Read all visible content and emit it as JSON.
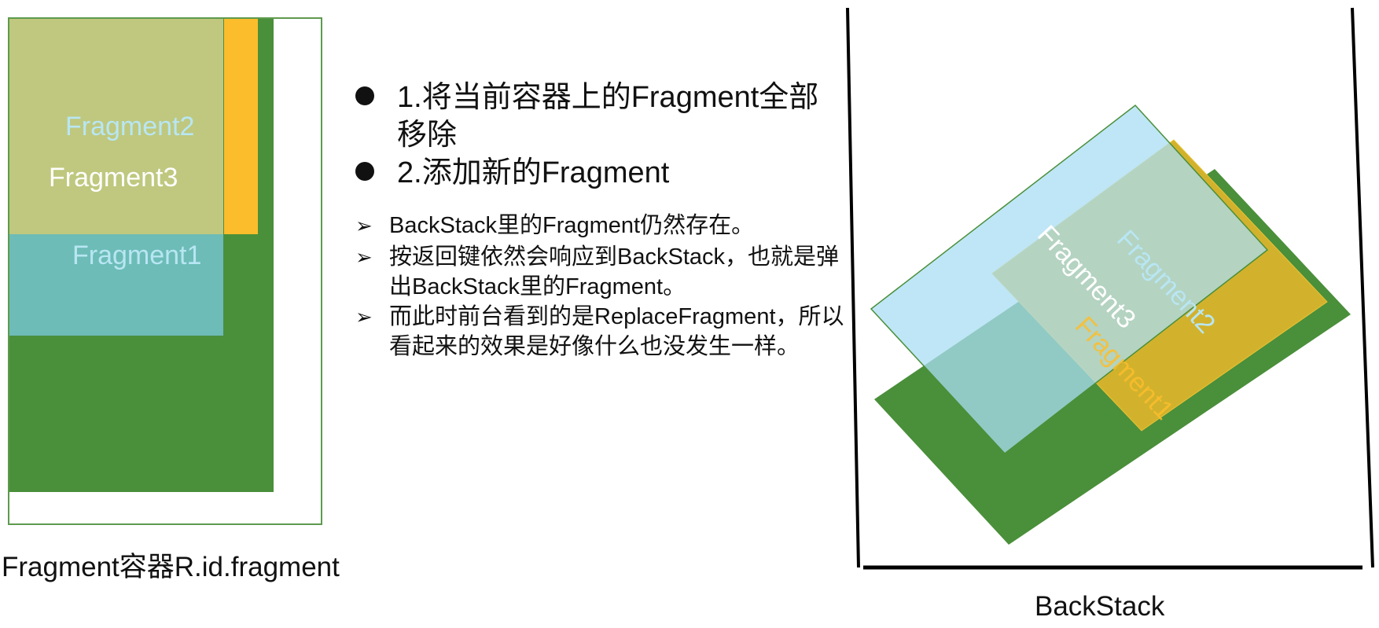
{
  "container": {
    "labels": {
      "fragment2": "Fragment2",
      "fragment3": "Fragment3",
      "fragment1": "Fragment1"
    },
    "caption": "Fragment容器R.id.fragment"
  },
  "bullets": [
    {
      "text": "1.将当前容器上的Fragment全部移除"
    },
    {
      "text": "2.添加新的Fragment"
    }
  ],
  "notes": [
    {
      "text": "BackStack里的Fragment仍然存在。"
    },
    {
      "text": "按返回键依然会响应到BackStack，也就是弹出BackStack里的Fragment。"
    },
    {
      "text": "而此时前台看到的是ReplaceFragment，所以看起来的效果是好像什么也没发生一样。"
    }
  ],
  "backstack": {
    "caption": "BackStack",
    "labels": {
      "fragment3": "Fragment3",
      "fragment2": "Fragment2",
      "fragment1": "Fragment1"
    }
  },
  "colors": {
    "green": "#4a8f3a",
    "yellow": "#fbbd2c",
    "olive": "#bfc87e",
    "teal": "#6dbcb7",
    "light_blue": "#a9ddf3"
  }
}
